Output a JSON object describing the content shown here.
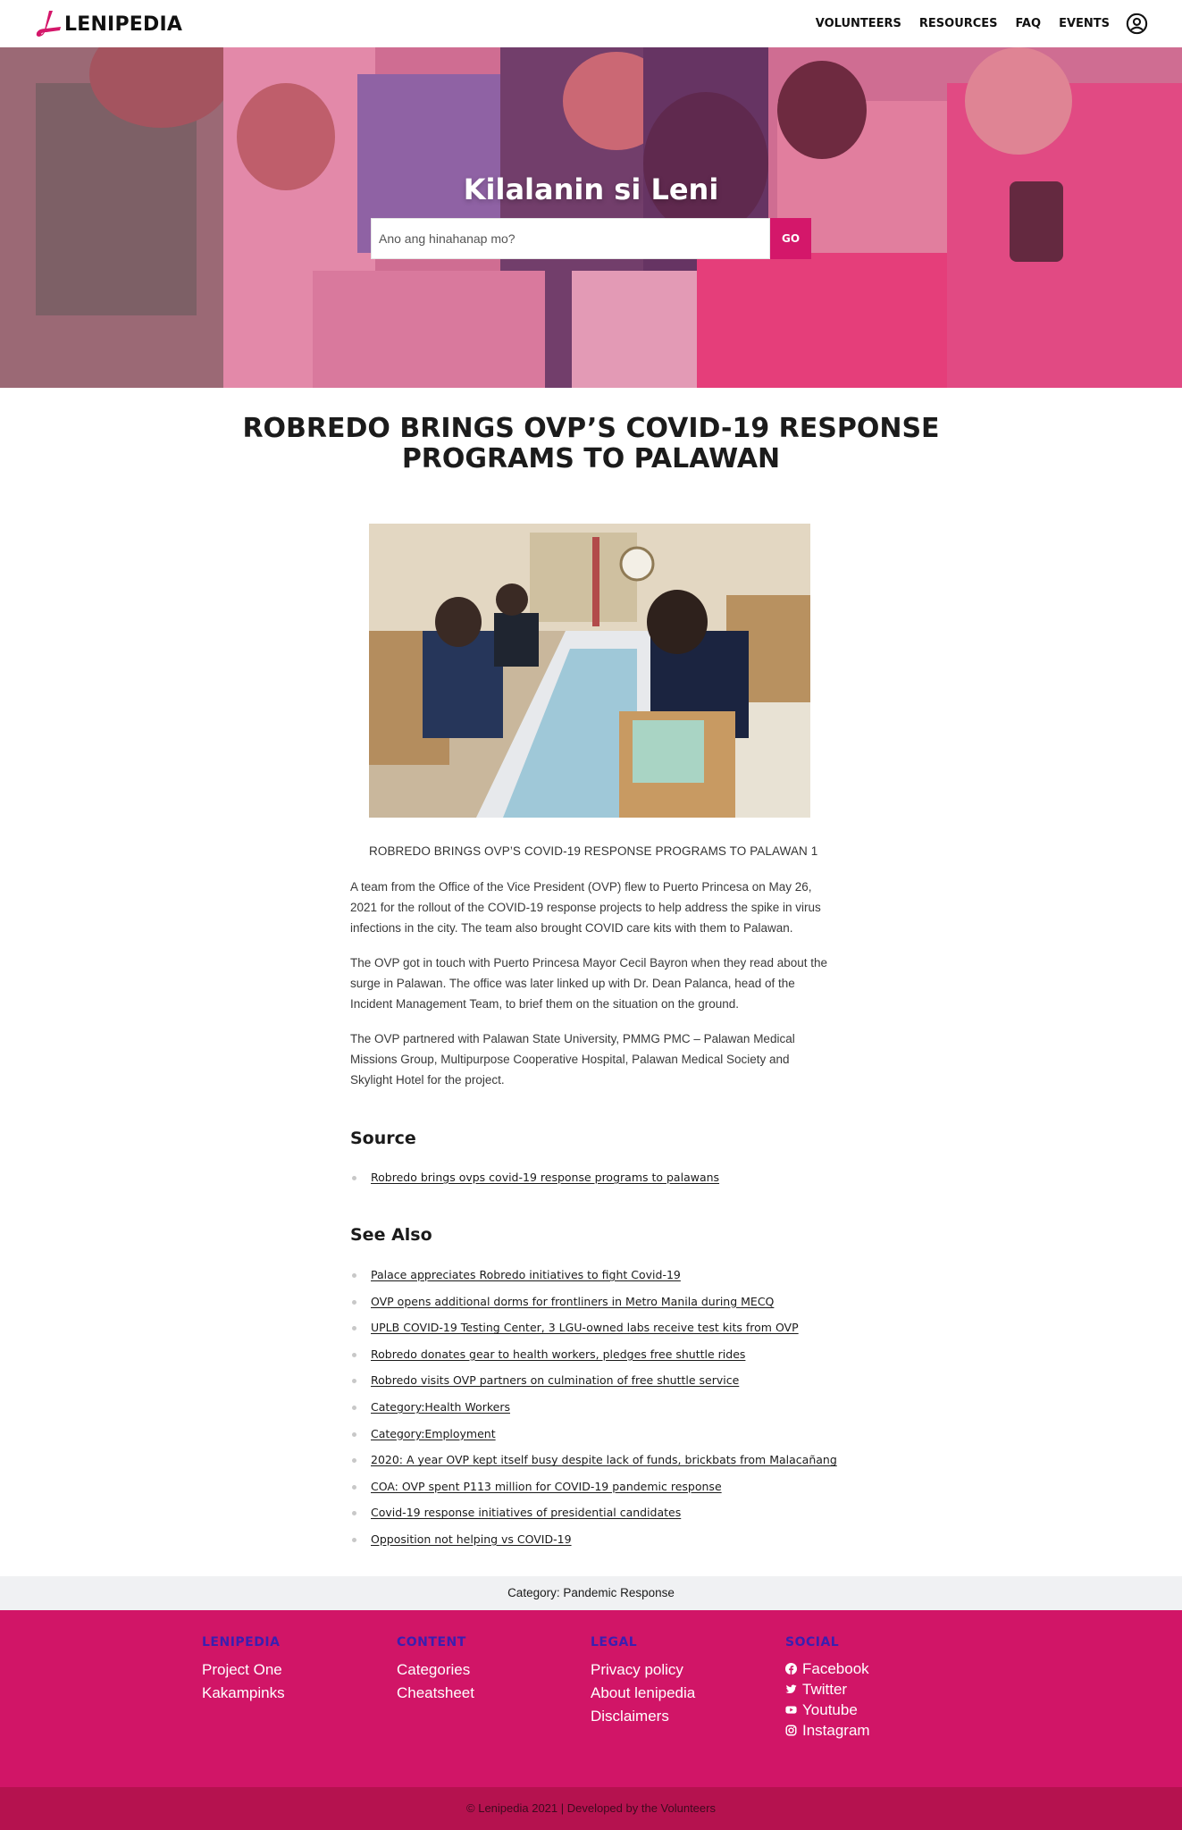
{
  "header": {
    "logo_text": "LENIPEDIA",
    "nav": [
      "VOLUNTEERS",
      "RESOURCES",
      "FAQ",
      "EVENTS"
    ],
    "user_icon": "user-circle-icon",
    "brand_color": "#d4176a"
  },
  "hero": {
    "title": "Kilalanin si Leni",
    "search_placeholder": "Ano ang hinahanap mo?",
    "search_value": "",
    "go_label": "GO"
  },
  "article": {
    "title": "ROBREDO BRINGS OVP’S COVID-19 RESPONSE PROGRAMS TO PALAWAN",
    "image_caption": "ROBREDO BRINGS OVP’S COVID-19 RESPONSE PROGRAMS TO PALAWAN 1",
    "paragraphs": [
      "A team from the Office of the Vice President (OVP) flew to Puerto Princesa on May 26, 2021 for the rollout of the COVID-19 response projects to help address the spike in virus infections in the city. The team also brought COVID care kits with them to Palawan.",
      "The OVP got in touch with Puerto Princesa Mayor Cecil Bayron when they read about the surge in Palawan. The office was later linked up with Dr. Dean Palanca, head of the Incident Management Team, to brief them on the situation on the ground.",
      "The OVP partnered with Palawan State University, PMMG PMC – Palawan Medical Missions Group, Multipurpose Cooperative Hospital, Palawan Medical Society and Skylight Hotel for the project."
    ]
  },
  "source": {
    "heading": "Source",
    "links": [
      "Robredo brings ovps covid-19 response programs to palawans"
    ]
  },
  "see_also": {
    "heading": "See Also",
    "links": [
      "Palace appreciates Robredo initiatives to fight Covid-19",
      "OVP opens additional dorms for frontliners in Metro Manila during MECQ",
      "UPLB COVID-19 Testing Center, 3 LGU-owned labs receive test kits from OVP",
      "Robredo donates gear to health workers, pledges free shuttle rides",
      "Robredo visits OVP partners on culmination of free shuttle service",
      "Category:Health Workers",
      "Category:Employment",
      "2020: A year OVP kept itself busy despite lack of funds, brickbats from Malacañang",
      "COA: OVP spent P113 million for COVID-19 pandemic response",
      "Covid-19 response initiatives of presidential candidates",
      "Opposition not helping vs COVID-19"
    ]
  },
  "category_bar": {
    "label": "Category:",
    "value": "Pandemic Response"
  },
  "footer": {
    "columns": [
      {
        "heading": "LENIPEDIA",
        "links": [
          "Project One",
          "Kakampinks"
        ]
      },
      {
        "heading": "CONTENT",
        "links": [
          "Categories",
          "Cheatsheet"
        ]
      },
      {
        "heading": "LEGAL",
        "links": [
          "Privacy policy",
          "About lenipedia",
          "Disclaimers"
        ]
      }
    ],
    "social": {
      "heading": "SOCIAL",
      "links": [
        {
          "label": "Facebook",
          "icon": "facebook-icon"
        },
        {
          "label": "Twitter",
          "icon": "twitter-icon"
        },
        {
          "label": "Youtube",
          "icon": "youtube-icon"
        },
        {
          "label": "Instagram",
          "icon": "instagram-icon"
        }
      ]
    },
    "copyright": "© Lenipedia 2021 | Developed by the Volunteers",
    "background_color": "#d11567",
    "heading_color": "#3a1fb0"
  }
}
